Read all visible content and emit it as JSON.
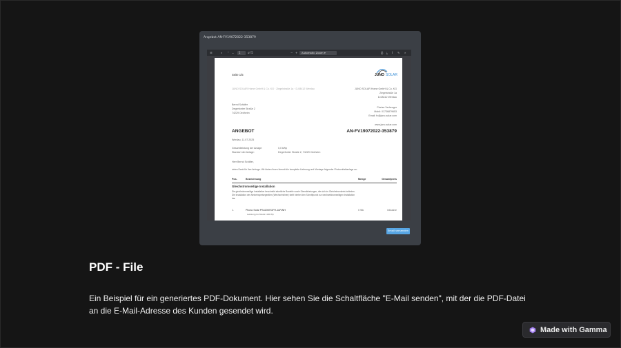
{
  "modal": {
    "title": "Angebot AN-FV19072022-353879",
    "toolbar": {
      "page_input": "1",
      "page_total": "of 5",
      "zoom": "Automatic Zoom",
      "minus": "−",
      "plus": "+"
    },
    "send_button": "Email versenden"
  },
  "pdf": {
    "page_label": "Seite 1/5",
    "logo_text_1": "JUNO",
    "logo_text_2": "SOLAR",
    "sender_line": "JUNO SOLAR Home GmbH & Co. KG · Ziegelstraße 1a · D-08412 Werdau",
    "company": [
      "JUNO SOLAR Home GmbH & Co. KG",
      "Ziegelstraße 1a",
      "D-08412 Werdau"
    ],
    "customer": [
      "Bernd Schäfer",
      "Degerfonter Straße 2",
      "74229 Oedheim"
    ],
    "contact": [
      "Florian Verheuger",
      "Mobil: 01736879653",
      "Email: fv@juno-solar.com"
    ],
    "website": "www.juno-solar.com",
    "doc_type": "ANGEBOT",
    "doc_number": "AN-FV19072022-353879",
    "date": "Werdau, 11.07.2025",
    "installed_power_label": "Gesamtleistung der Anlage:",
    "installed_power_value": "0,0 kWp",
    "location_label": "Standort der Anlage:",
    "location_value": "Degerfonter Straße 2, 74229 Oedheim",
    "salutation": "Herr Bernd Schäfer,",
    "intro": "vielen Dank für Ihre Anfrage. Wir bieten Ihnen hiermit die komplette Lieferung und Montage folgender Photovoltaikanlage an:",
    "table_headers": {
      "pos": "Pos.",
      "desc": "Bezeichnung",
      "qty": "Menge",
      "total": "Gesamtpreis"
    },
    "section_title": "Gleichstromseitige Installation",
    "section_text": [
      "Die gleichstromseitige Installation beschreibt sämtliche Bauteile sowie Dienstleistungen, die sich im Gleichstromkreis befinden.",
      "Die Installation des Netzeinspeisegeräten (Wechselrichter) stellt hierbei den Schnittpunkt zur wechselstromseitigen Installation",
      "dar."
    ],
    "row1": {
      "pos": "1.",
      "desc": "Phono Solar PS420M7GFH-18/VNH",
      "sub": "Leistung pro Modul: 420 Wp",
      "qty": "0 Stk",
      "total": "inklusive"
    }
  },
  "heading": "PDF - File",
  "description": "Ein Beispiel für ein generiertes PDF-Dokument. Hier sehen Sie die Schaltfläche \"E-Mail senden\", mit der die PDF-Datei an die E-Mail-Adresse des Kunden gesendet wird.",
  "badge": {
    "label": "Made with Gamma",
    "icon": "gamma-logo-icon",
    "accent": "#a17cf0"
  },
  "colors": {
    "background": "#151515",
    "modal": "#3b3f45",
    "button": "#58a6e4"
  }
}
